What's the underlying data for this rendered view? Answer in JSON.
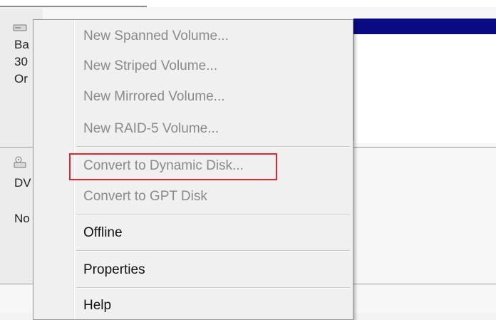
{
  "disks": [
    {
      "label_lines": [
        "Ba",
        "30",
        "Or"
      ],
      "icon": "disk-drive-icon"
    },
    {
      "label_lines": [
        "DV",
        "",
        "No"
      ],
      "icon": "dvd-drive-icon"
    }
  ],
  "context_menu": {
    "items": [
      {
        "label": "New Spanned Volume...",
        "enabled": false
      },
      {
        "label": "New Striped Volume...",
        "enabled": false
      },
      {
        "label": "New Mirrored Volume...",
        "enabled": false
      },
      {
        "label": "New RAID-5 Volume...",
        "enabled": false
      },
      {
        "label": "Convert to Dynamic Disk...",
        "enabled": false,
        "highlighted": true
      },
      {
        "label": "Convert to GPT Disk",
        "enabled": false
      },
      {
        "label": "Offline",
        "enabled": true
      },
      {
        "label": "Properties",
        "enabled": true
      },
      {
        "label": "Help",
        "enabled": true
      }
    ]
  },
  "colors": {
    "partition_header": "#0a0a82",
    "highlight_border": "#e0262e",
    "disabled_text": "#8a8a8a"
  }
}
